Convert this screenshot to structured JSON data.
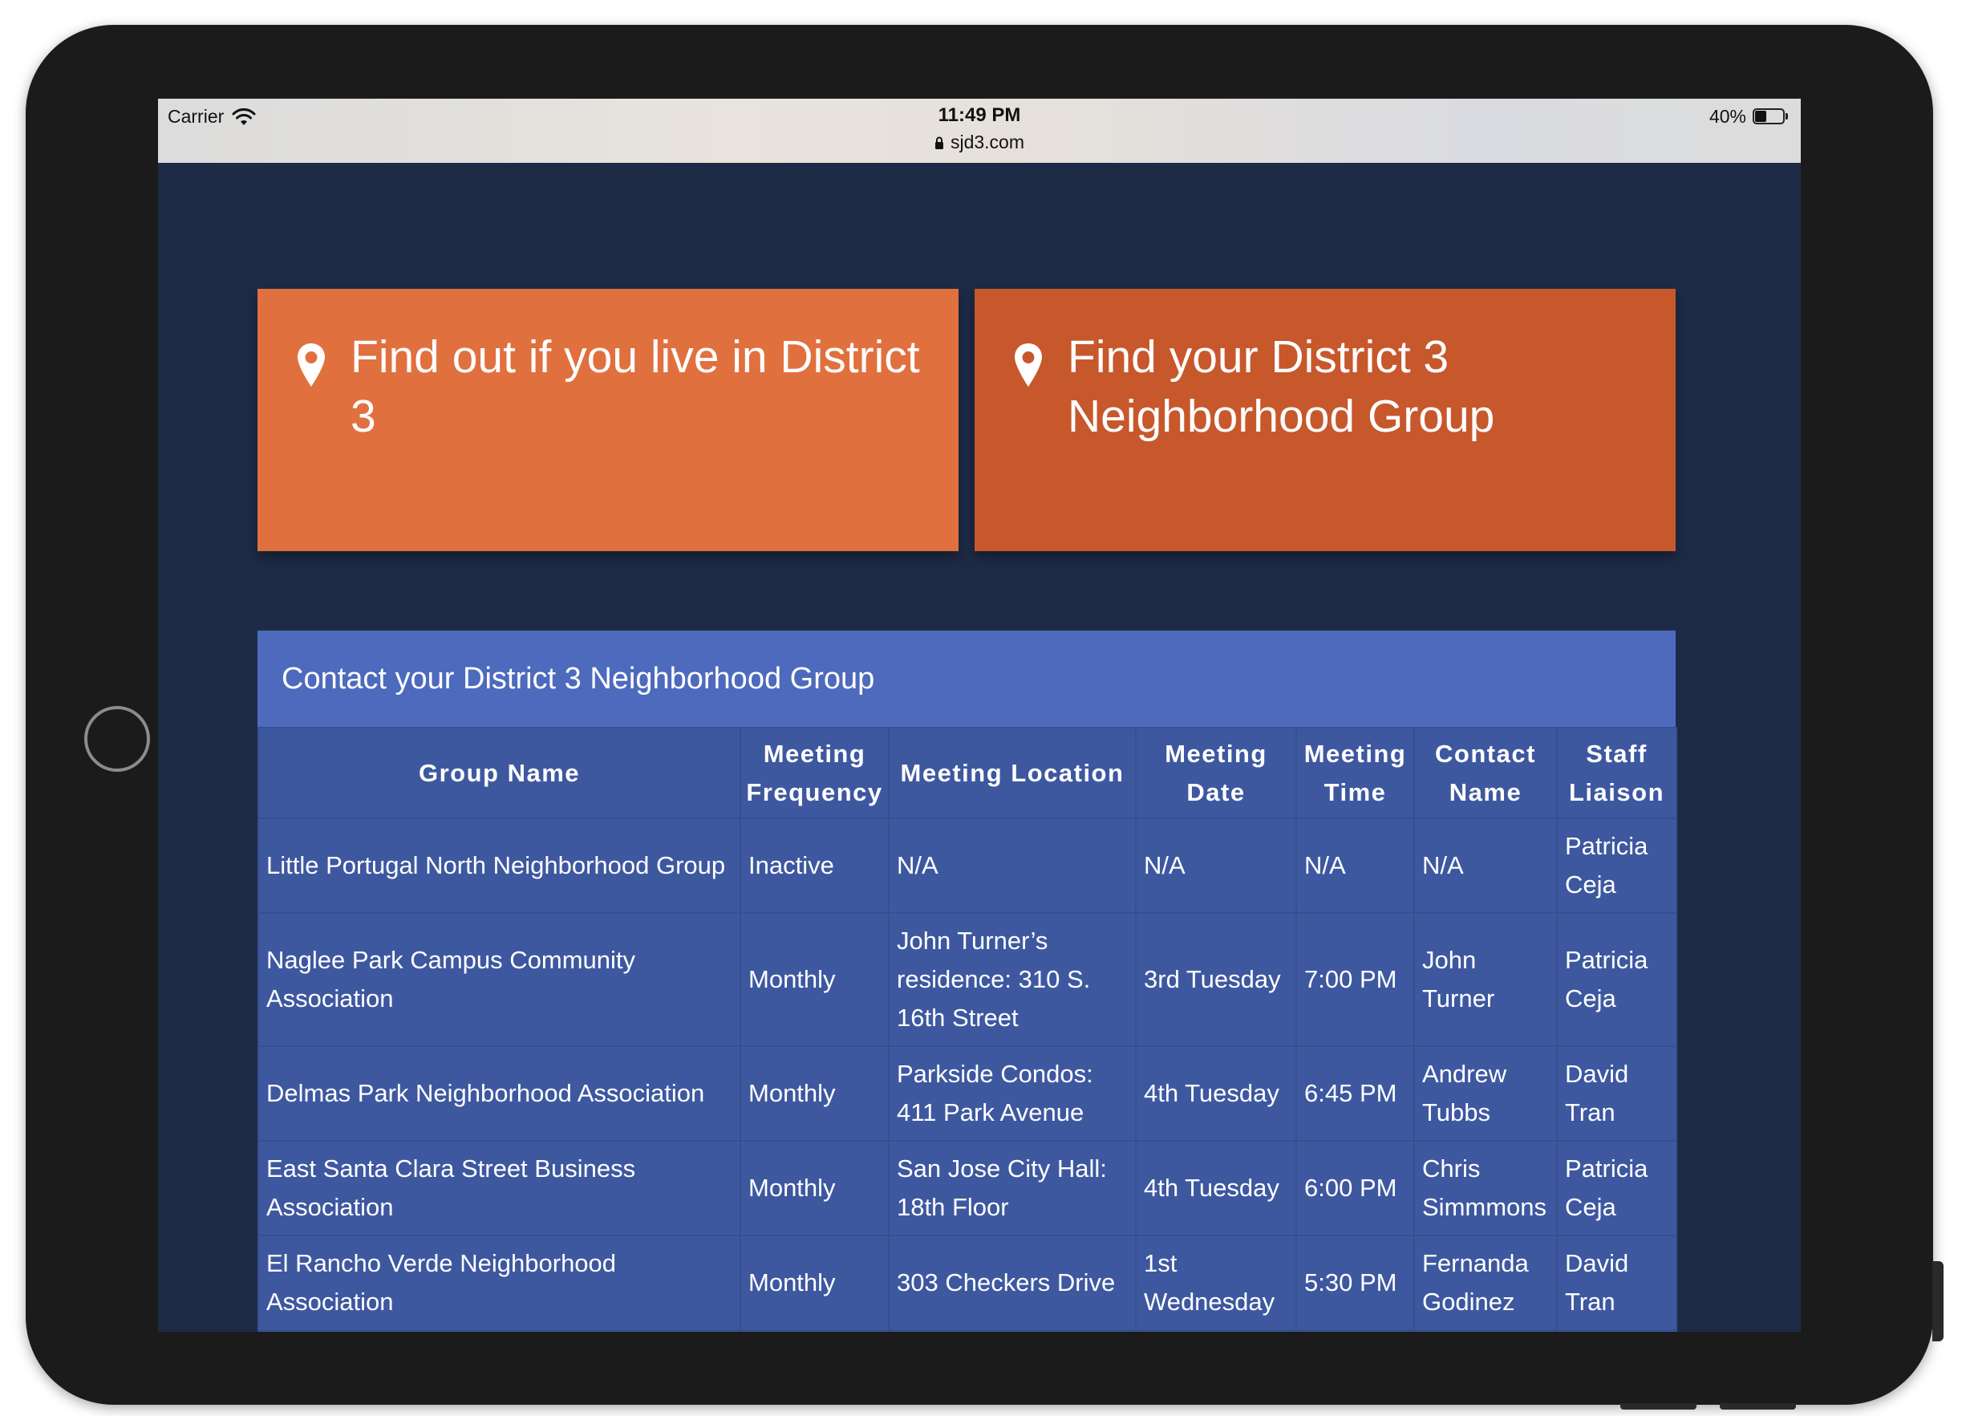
{
  "status_bar": {
    "carrier": "Carrier",
    "time": "11:49 PM",
    "url": "sjd3.com",
    "battery_percent": "40%",
    "battery_level": 0.4
  },
  "cards": [
    {
      "icon": "map-pin-icon",
      "text": "Find out if you live in District 3",
      "color": "#e1703f"
    },
    {
      "icon": "map-pin-icon",
      "text": "Find your District 3 Neighborhood Group",
      "color": "#c7582c"
    }
  ],
  "table": {
    "title": "Contact your District 3 Neighborhood Group",
    "headers": [
      "Group Name",
      "Meeting Frequency",
      "Meeting Location",
      "Meeting Date",
      "Meeting Time",
      "Contact Name",
      "Staff Liaison"
    ],
    "rows": [
      [
        "Little Portugal North Neighborhood Group",
        "Inactive",
        "N/A",
        "N/A",
        "N/A",
        "N/A",
        "Patricia Ceja"
      ],
      [
        "Naglee Park Campus Community Association",
        "Monthly",
        "John Turner’s residence: 310 S. 16th Street",
        "3rd Tuesday",
        "7:00 PM",
        "John Turner",
        "Patricia Ceja"
      ],
      [
        "Delmas Park Neighborhood Association",
        "Monthly",
        "Parkside Condos: 411 Park Avenue",
        "4th Tuesday",
        "6:45 PM",
        "Andrew Tubbs",
        "David Tran"
      ],
      [
        "East Santa Clara Street Business Association",
        "Monthly",
        "San Jose City Hall: 18th Floor",
        "4th Tuesday",
        "6:00 PM",
        "Chris Simmmons",
        "Patricia Ceja"
      ],
      [
        "El Rancho Verde Neighborhood Association",
        "Monthly",
        "303 Checkers Drive",
        "1st Wednesday",
        "5:30 PM",
        "Fernanda Godinez",
        "David Tran"
      ],
      [
        "",
        "",
        "",
        "",
        "",
        "",
        ""
      ]
    ]
  },
  "colors": {
    "page_background": "#1e2b47",
    "table_header": "#4d6abd",
    "table_body": "#3e58a0"
  }
}
